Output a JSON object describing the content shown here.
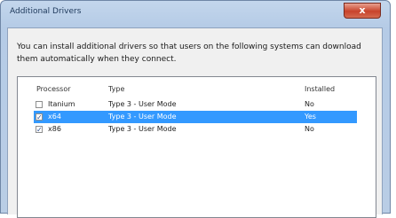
{
  "window": {
    "title": "Additional Drivers",
    "close_glyph": "x"
  },
  "description": "You can install additional drivers so that users on the following systems can download them automatically when they connect.",
  "list": {
    "columns": {
      "processor": "Processor",
      "type": "Type",
      "installed": "Installed"
    },
    "rows": [
      {
        "processor": "Itanium",
        "type": "Type 3 - User Mode",
        "installed": "No",
        "checked": false,
        "selected": false
      },
      {
        "processor": "x64",
        "type": "Type 3 - User Mode",
        "installed": "Yes",
        "checked": true,
        "selected": true
      },
      {
        "processor": "x86",
        "type": "Type 3 - User Mode",
        "installed": "No",
        "checked": true,
        "selected": false
      }
    ]
  },
  "colors": {
    "selection": "#3399ff",
    "close_button": "#c8432b",
    "title_bar": "#b9cde5"
  },
  "icons": {
    "checkbox": "checkbox-icon",
    "close": "close-icon"
  }
}
